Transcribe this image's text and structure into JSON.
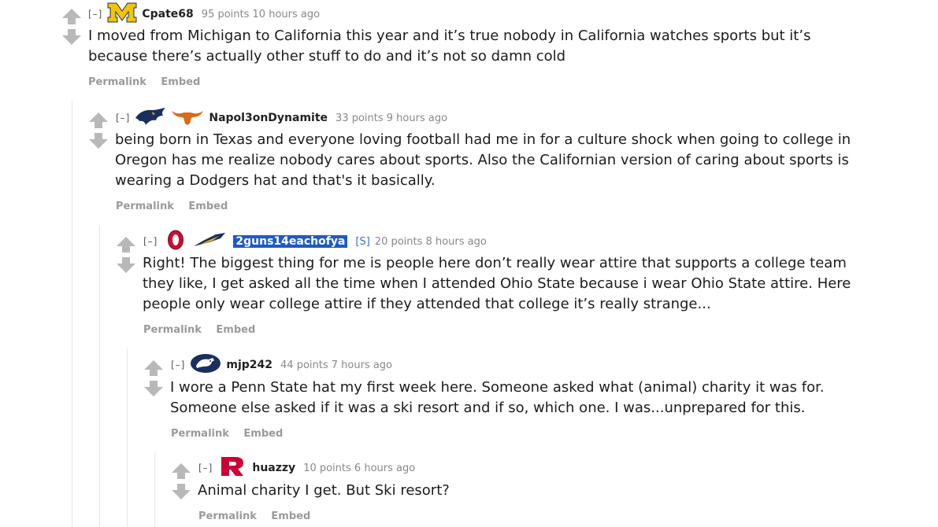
{
  "comments": [
    {
      "author": "Cpate68",
      "collapse": "[–]",
      "meta": "95 points 10 hours ago",
      "body": "I moved from Michigan to California this year and it’s true nobody in California watches sports but it’s because there’s actually other stuff to do and it’s not so damn cold",
      "actions": [
        "Permalink",
        "Embed"
      ],
      "flairs": [
        "michigan-logo"
      ]
    },
    {
      "author": "Napol3onDynamite",
      "collapse": "[–]",
      "meta": "33 points 9 hours ago",
      "body": "being born in Texas and everyone loving football had me in for a culture shock when going to college in Oregon has me realize nobody cares about sports. Also the Californian version of caring about sports is wearing a Dodgers hat and that's it basically.",
      "actions": [
        "Permalink",
        "Embed"
      ],
      "flairs": [
        "panther-logo",
        "longhorn-logo"
      ]
    },
    {
      "author": "2guns14eachofya",
      "collapse": "[–]",
      "sub_tag": "[S]",
      "meta": "20 points 8 hours ago",
      "body": "Right! The biggest thing for me is people here don’t really wear attire that supports a college team they like, I get asked all the time when I attended Ohio State because i wear Ohio State attire. Here people only wear college attire if they attended that college it’s really strange...",
      "actions": [
        "Permalink",
        "Embed"
      ],
      "flairs": [
        "ohio-state-logo",
        "rocket-logo"
      ]
    },
    {
      "author": "mjp242",
      "collapse": "[–]",
      "meta": "44 points 7 hours ago",
      "body": "I wore a Penn State hat my first week here. Someone asked what (animal) charity it was for. Someone else asked if it was a ski resort and if so, which one. I was...unprepared for this.",
      "actions": [
        "Permalink",
        "Embed"
      ],
      "flairs": [
        "penn-state-logo"
      ]
    },
    {
      "author": "huazzy",
      "collapse": "[–]",
      "meta": "10 points 6 hours ago",
      "body": "Animal charity I get. But Ski resort?",
      "actions": [
        "Permalink",
        "Embed"
      ],
      "flairs": [
        "rutgers-logo"
      ]
    }
  ],
  "colors": {
    "arrow": "#b8b8b8",
    "highlight": "#1f5ac8",
    "michigan_maize": "#f2c500",
    "ohio_red": "#c8102e",
    "penn_navy": "#1b2f5e",
    "texas_orange": "#d86a1a",
    "rutgers_red": "#cc0033"
  }
}
